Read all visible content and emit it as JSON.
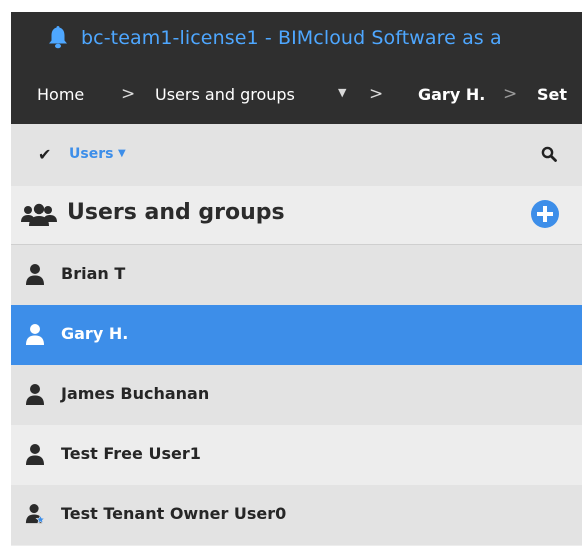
{
  "window": {
    "title": "bc-team1-license1 - BIMcloud Software as a",
    "icon": "bell-icon"
  },
  "breadcrumb": {
    "items": [
      "Home",
      "Users and groups",
      "Gary H.",
      "Set"
    ],
    "separator": ">"
  },
  "filter": {
    "label": "Users",
    "check_icon": "checkmark-icon",
    "search_icon": "search-icon"
  },
  "section": {
    "title": "Users and groups",
    "icon": "users-group-icon",
    "add_icon": "plus-circle-icon"
  },
  "users": [
    {
      "name": "Brian T",
      "icon": "user-icon",
      "selected": false
    },
    {
      "name": "Gary H.",
      "icon": "user-icon",
      "selected": true
    },
    {
      "name": "James Buchanan",
      "icon": "user-icon",
      "selected": false
    },
    {
      "name": "Test Free User1",
      "icon": "user-icon",
      "selected": false
    },
    {
      "name": "Test Tenant Owner User0",
      "icon": "user-owner-icon",
      "selected": false
    }
  ],
  "colors": {
    "accent": "#3d8ee9",
    "title_blue": "#4ea7ff",
    "dark_bar": "#2f2f2f"
  }
}
